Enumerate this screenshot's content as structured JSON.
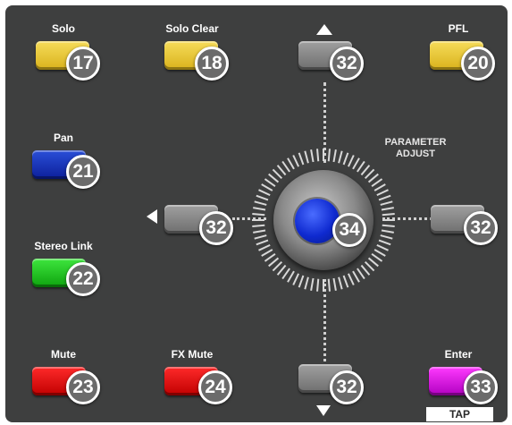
{
  "buttons": {
    "solo": {
      "label": "Solo",
      "number": "17",
      "color": "#e8c63a"
    },
    "solo_clear": {
      "label": "Solo Clear",
      "number": "18",
      "color": "#e8c63a"
    },
    "pfl": {
      "label": "PFL",
      "number": "20",
      "color": "#e8c63a"
    },
    "pan": {
      "label": "Pan",
      "number": "21",
      "color": "#1a3fd0"
    },
    "stereo_link": {
      "label": "Stereo Link",
      "number": "22",
      "color": "#22cc22"
    },
    "mute": {
      "label": "Mute",
      "number": "23",
      "color": "#e01010"
    },
    "fx_mute": {
      "label": "FX Mute",
      "number": "24",
      "color": "#e01010"
    },
    "enter": {
      "label": "Enter",
      "number": "33",
      "color": "#e020e0"
    }
  },
  "param_adjust": {
    "label": "PARAMETER ADJUST",
    "up_number": "32",
    "down_number": "32",
    "left_number": "32",
    "right_number": "32",
    "dial_number": "34",
    "dial_color": "#1530d8"
  },
  "tap_label": "TAP"
}
